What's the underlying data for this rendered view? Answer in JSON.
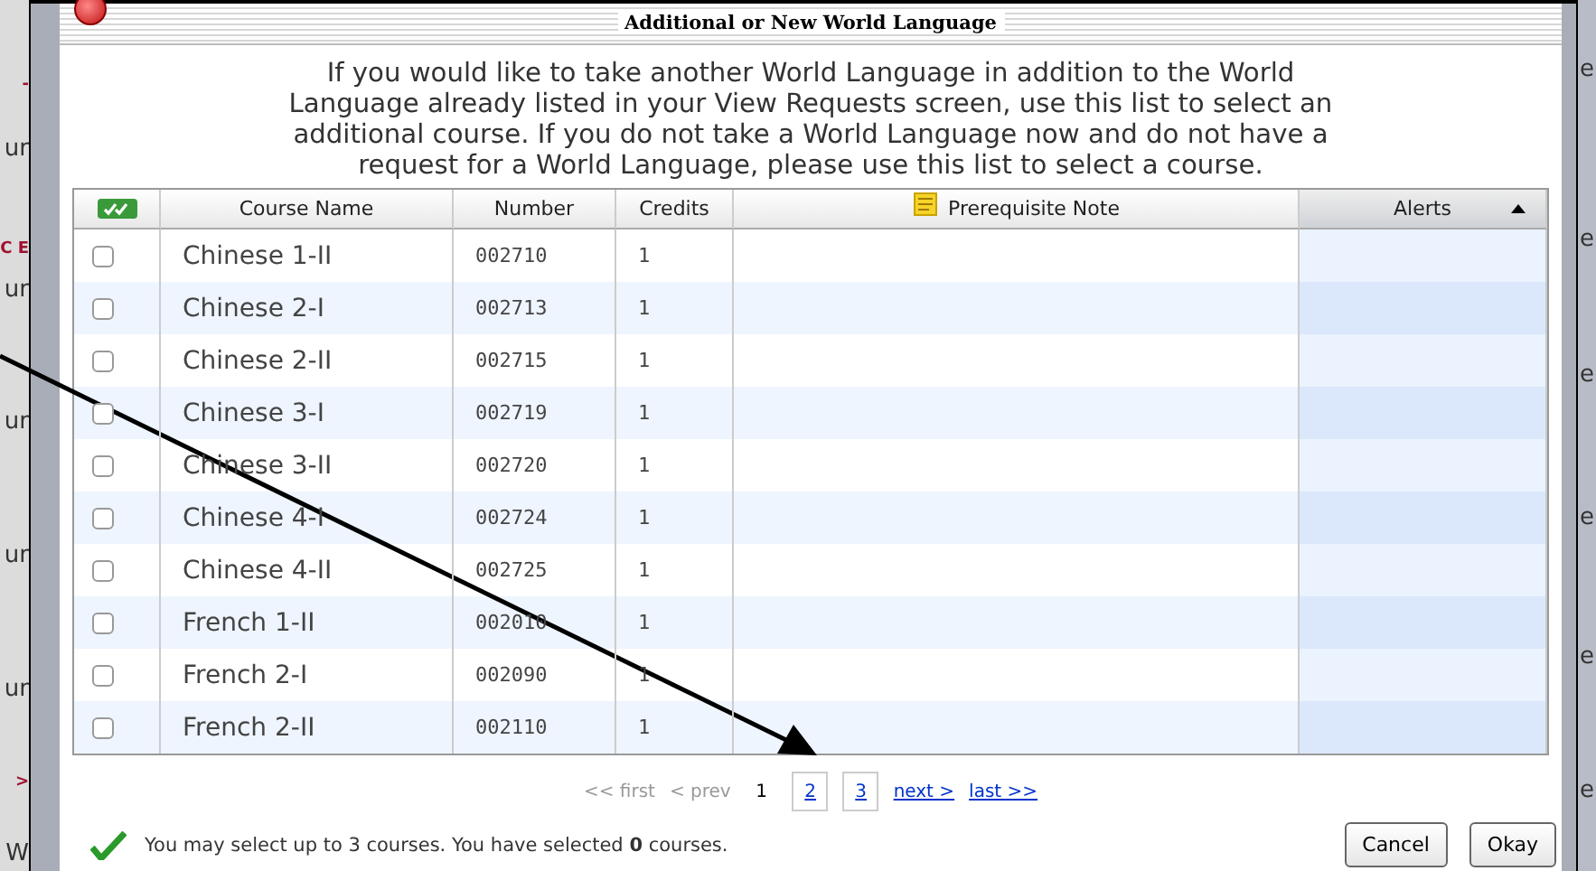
{
  "background": {
    "left_fragments": [
      {
        "text": "-",
        "kind": "accent"
      },
      {
        "text": "ur",
        "kind": "plain"
      },
      {
        "text": "C E",
        "kind": "accent"
      },
      {
        "text": "ur",
        "kind": "plain"
      },
      {
        "text": "ur",
        "kind": "plain"
      },
      {
        "text": "ur",
        "kind": "plain"
      },
      {
        "text": "ur",
        "kind": "plain"
      },
      {
        "text": ">",
        "kind": "accent"
      },
      {
        "text": "W",
        "kind": "plain"
      }
    ],
    "right_fragments": [
      "e",
      "e",
      "e",
      "e",
      "e",
      "e"
    ]
  },
  "dialog": {
    "title": "Additional or New World Language",
    "intro": "If you would like to take another World Language in addition to the World Language already listed in your View Requests screen, use this list to select an additional course. If you do not take a World Language now and do not have a request for a World Language, please use this list to select a course.",
    "table": {
      "columns": [
        {
          "kind": "select-all"
        },
        {
          "kind": "text",
          "label": "Course Name"
        },
        {
          "kind": "text",
          "label": "Number"
        },
        {
          "kind": "text",
          "label": "Credits"
        },
        {
          "kind": "note",
          "label": "Prerequisite Note"
        },
        {
          "kind": "sorted",
          "label": "Alerts",
          "ascending": true
        }
      ],
      "rows": [
        {
          "name": "Chinese 1-II",
          "number": "002710",
          "credits": "1",
          "checked": false
        },
        {
          "name": "Chinese 2-I",
          "number": "002713",
          "credits": "1",
          "checked": false
        },
        {
          "name": "Chinese 2-II",
          "number": "002715",
          "credits": "1",
          "checked": false
        },
        {
          "name": "Chinese 3-I",
          "number": "002719",
          "credits": "1",
          "checked": false
        },
        {
          "name": "Chinese 3-II",
          "number": "002720",
          "credits": "1",
          "checked": false
        },
        {
          "name": "Chinese 4-I",
          "number": "002724",
          "credits": "1",
          "checked": false
        },
        {
          "name": "Chinese 4-II",
          "number": "002725",
          "credits": "1",
          "checked": false
        },
        {
          "name": "French 1-II",
          "number": "002010",
          "credits": "1",
          "checked": false
        },
        {
          "name": "French 2-I",
          "number": "002090",
          "credits": "1",
          "checked": false
        },
        {
          "name": "French 2-II",
          "number": "002110",
          "credits": "1",
          "checked": false
        }
      ]
    },
    "pagination": [
      {
        "label": "<< first",
        "kind": "nav",
        "disabled": true
      },
      {
        "label": "< prev",
        "kind": "nav",
        "disabled": true
      },
      {
        "label": "1",
        "kind": "page",
        "selected": true
      },
      {
        "label": "2",
        "kind": "page",
        "selected": false
      },
      {
        "label": "3",
        "kind": "page",
        "selected": false
      },
      {
        "label": "next >",
        "kind": "nav",
        "disabled": false
      },
      {
        "label": "last >>",
        "kind": "nav",
        "disabled": false
      }
    ],
    "status": "You may select up to 3 courses. You have selected **0** courses.",
    "buttons": [
      "Cancel",
      "Okay"
    ]
  }
}
